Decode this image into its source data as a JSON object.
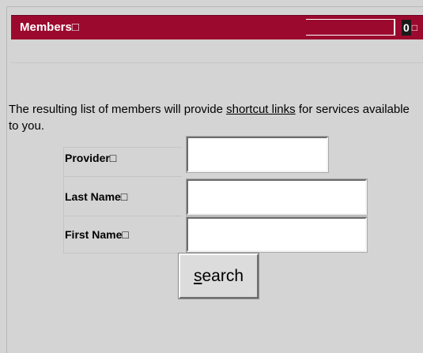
{
  "header": {
    "title": "Members□",
    "counter": "0",
    "counter_glyph": "□"
  },
  "intro": {
    "text_before": "The resulting list of members will provide ",
    "link_text": "shortcut links",
    "text_after": " for services available to you."
  },
  "form": {
    "provider_label": "Provider□",
    "last_name_label": "Last Name□",
    "first_name_label": "First Name□",
    "provider_value": "",
    "last_name_value": "",
    "first_name_value": ""
  },
  "search_button": {
    "access_key": "s",
    "label_rest": "earch"
  },
  "colors": {
    "header_bg": "#9b0a2e",
    "page_bg": "#d4d4d4"
  }
}
